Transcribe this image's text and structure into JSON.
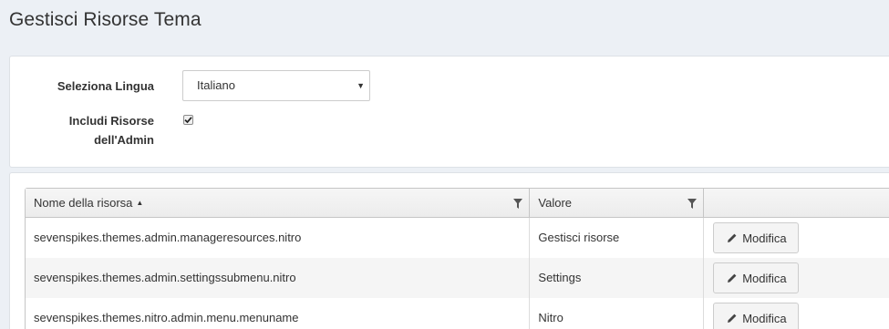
{
  "page": {
    "title": "Gestisci Risorse Tema"
  },
  "settings": {
    "language_label": "Seleziona Lingua",
    "language_value": "Italiano",
    "include_admin_label_line1": "Includi Risorse",
    "include_admin_label_line2": "dell'Admin",
    "include_admin_checked": true
  },
  "grid": {
    "columns": {
      "name": "Nome della risorsa",
      "value": "Valore"
    },
    "sort_indicator": "▲",
    "rows": [
      {
        "name": "sevenspikes.themes.admin.manageresources.nitro",
        "value": "Gestisci risorse",
        "action": "Modifica"
      },
      {
        "name": "sevenspikes.themes.admin.settingssubmenu.nitro",
        "value": "Settings",
        "action": "Modifica"
      },
      {
        "name": "sevenspikes.themes.nitro.admin.menu.menuname",
        "value": "Nitro",
        "action": "Modifica"
      }
    ]
  },
  "icons": {
    "filter": "filter-icon",
    "edit": "pencil-icon",
    "dropdown": "caret-down-icon",
    "check": "check-icon"
  },
  "colors": {
    "background": "#ecf0f5",
    "panel": "#ffffff",
    "header": "#f0f0f0",
    "button": "#f4f4f4",
    "alt_row": "#f5f5f5"
  }
}
